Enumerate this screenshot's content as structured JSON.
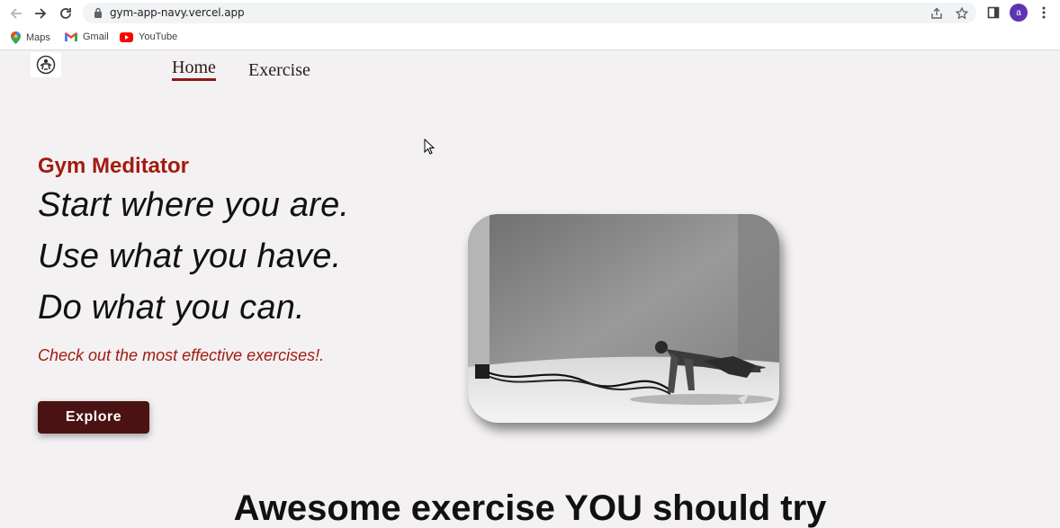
{
  "browser": {
    "url": "gym-app-navy.vercel.app",
    "avatar_letter": "a",
    "bookmarks": [
      {
        "label": "Maps",
        "icon": "maps-pin-icon"
      },
      {
        "label": "Gmail",
        "icon": "gmail-icon"
      },
      {
        "label": "YouTube",
        "icon": "youtube-icon"
      }
    ]
  },
  "nav": {
    "home": "Home",
    "exercise": "Exercise"
  },
  "hero": {
    "brand": "Gym Meditator",
    "line1": "Start where you are.",
    "line2": "Use what you have.",
    "line3": "Do what you can.",
    "subtitle": "Check out the most effective exercises!.",
    "button": "Explore"
  },
  "section": {
    "title": "Awesome exercise YOU should try"
  },
  "colors": {
    "brand": "#a31b0f",
    "button_bg": "#4a1212",
    "page_bg": "#f3f1f2",
    "avatar": "#5e35b1"
  }
}
